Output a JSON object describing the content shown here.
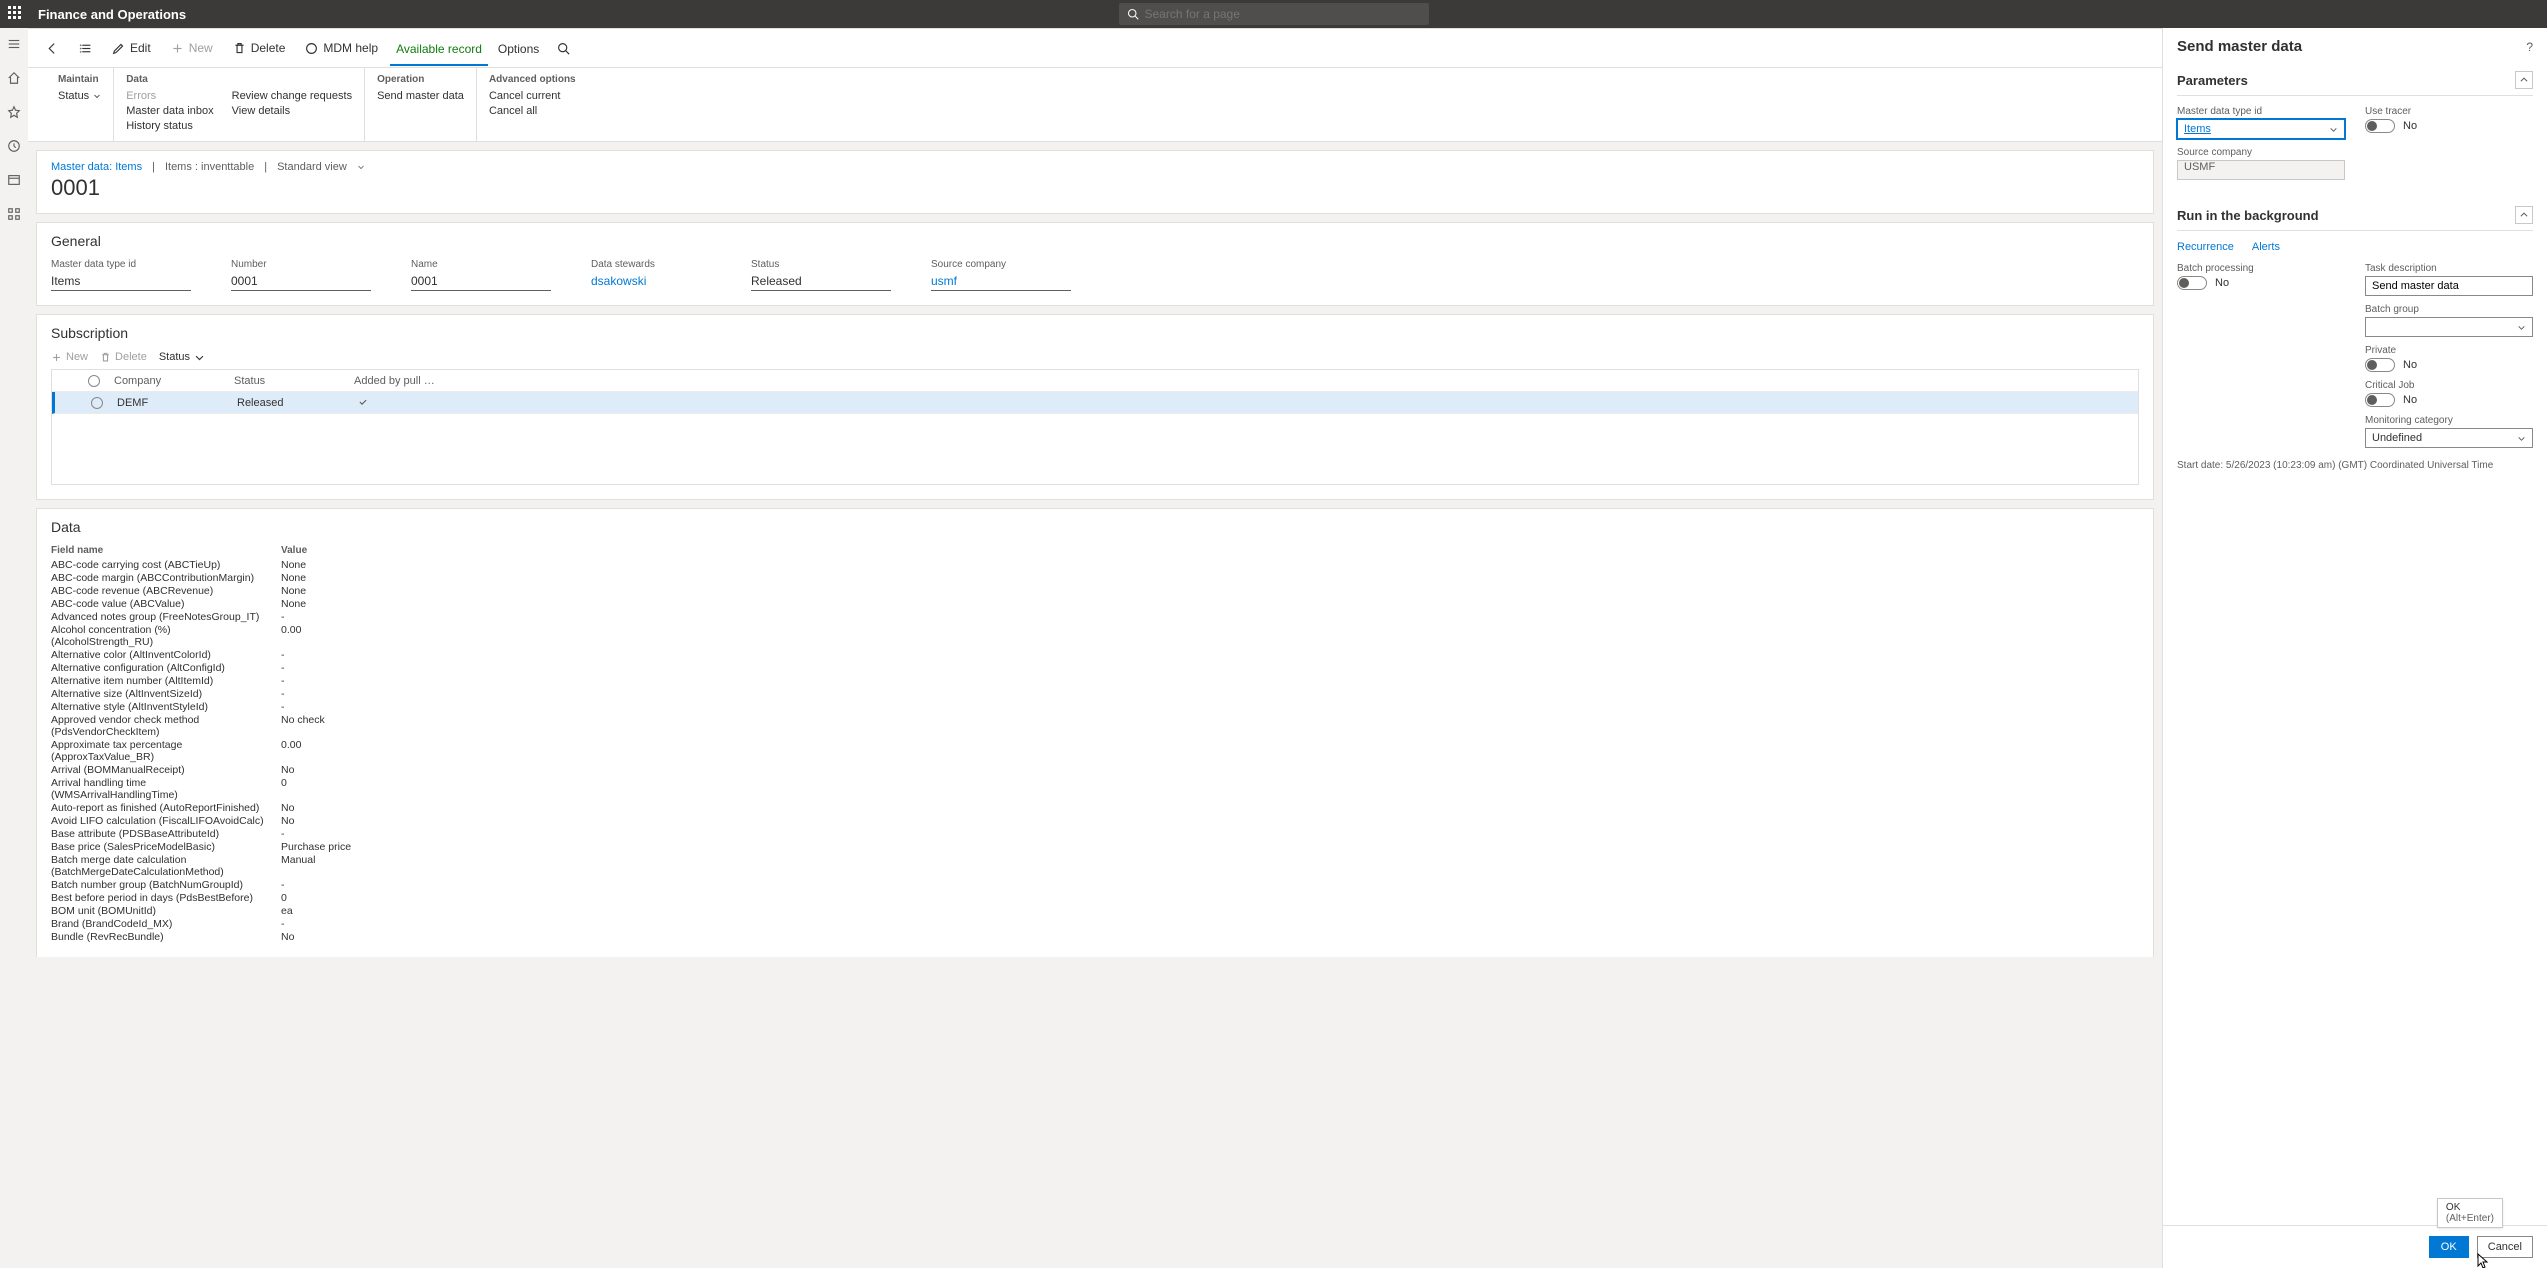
{
  "app_title": "Finance and Operations",
  "search_placeholder": "Search for a page",
  "actionbar": {
    "edit": "Edit",
    "new": "New",
    "delete": "Delete",
    "mdm_help": "MDM help",
    "available_record": "Available record",
    "options": "Options"
  },
  "ribbon": {
    "maintain": {
      "title": "Maintain",
      "status": "Status"
    },
    "data": {
      "title": "Data",
      "errors": "Errors",
      "inbox": "Master data inbox",
      "history": "History status",
      "review": "Review change requests",
      "view_details": "View details"
    },
    "operation": {
      "title": "Operation",
      "send": "Send master data"
    },
    "advanced": {
      "title": "Advanced options",
      "cancel_current": "Cancel current",
      "cancel_all": "Cancel all"
    }
  },
  "breadcrumb": {
    "link": "Master data: Items",
    "items": "Items : inventtable",
    "view": "Standard view"
  },
  "page_title": "0001",
  "general": {
    "title": "General",
    "fields": {
      "mdtid": {
        "label": "Master data type id",
        "value": "Items"
      },
      "number": {
        "label": "Number",
        "value": "0001"
      },
      "name": {
        "label": "Name",
        "value": "0001"
      },
      "stewards": {
        "label": "Data stewards",
        "value": "dsakowski"
      },
      "status": {
        "label": "Status",
        "value": "Released"
      },
      "company": {
        "label": "Source company",
        "value": "usmf"
      }
    }
  },
  "subscription": {
    "title": "Subscription",
    "toolbar": {
      "new": "New",
      "delete": "Delete",
      "status": "Status"
    },
    "columns": {
      "company": "Company",
      "status": "Status",
      "added": "Added by pull …"
    },
    "row": {
      "company": "DEMF",
      "status": "Released"
    }
  },
  "data_section": {
    "title": "Data",
    "headers": {
      "field": "Field name",
      "value": "Value"
    },
    "rows": [
      {
        "f": "ABC-code carrying cost (ABCTieUp)",
        "v": "None"
      },
      {
        "f": "ABC-code margin (ABCContributionMargin)",
        "v": "None"
      },
      {
        "f": "ABC-code revenue (ABCRevenue)",
        "v": "None"
      },
      {
        "f": "ABC-code value (ABCValue)",
        "v": "None"
      },
      {
        "f": "Advanced notes group (FreeNotesGroup_IT)",
        "v": "-"
      },
      {
        "f": "Alcohol concentration (%) (AlcoholStrength_RU)",
        "v": "0.00"
      },
      {
        "f": "Alternative color (AltInventColorId)",
        "v": "-"
      },
      {
        "f": "Alternative configuration (AltConfigId)",
        "v": "-"
      },
      {
        "f": "Alternative item number (AltItemId)",
        "v": "-"
      },
      {
        "f": "Alternative size (AltInventSizeId)",
        "v": "-"
      },
      {
        "f": "Alternative style (AltInventStyleId)",
        "v": "-"
      },
      {
        "f": "Approved vendor check method (PdsVendorCheckItem)",
        "v": "No check"
      },
      {
        "f": "Approximate tax percentage (ApproxTaxValue_BR)",
        "v": "0.00"
      },
      {
        "f": "Arrival (BOMManualReceipt)",
        "v": "No"
      },
      {
        "f": "Arrival handling time (WMSArrivalHandlingTime)",
        "v": "0"
      },
      {
        "f": "Auto-report as finished (AutoReportFinished)",
        "v": "No"
      },
      {
        "f": "Avoid LIFO calculation (FiscalLIFOAvoidCalc)",
        "v": "No"
      },
      {
        "f": "Base attribute (PDSBaseAttributeId)",
        "v": "-"
      },
      {
        "f": "Base price (SalesPriceModelBasic)",
        "v": "Purchase price"
      },
      {
        "f": "Batch merge date calculation (BatchMergeDateCalculationMethod)",
        "v": "Manual"
      },
      {
        "f": "Batch number group (BatchNumGroupId)",
        "v": "-"
      },
      {
        "f": "Best before period in days (PdsBestBefore)",
        "v": "0"
      },
      {
        "f": "BOM unit (BOMUnitId)",
        "v": "ea"
      },
      {
        "f": "Brand (BrandCodeId_MX)",
        "v": "-"
      },
      {
        "f": "Bundle (RevRecBundle)",
        "v": "No"
      }
    ]
  },
  "panel": {
    "title": "Send master data",
    "parameters": {
      "title": "Parameters",
      "mdtid_label": "Master data type id",
      "mdtid_value": "Items",
      "tracer_label": "Use tracer",
      "tracer_value": "No",
      "source_label": "Source company",
      "source_value": "USMF"
    },
    "background": {
      "title": "Run in the background",
      "tabs": {
        "recurrence": "Recurrence",
        "alerts": "Alerts"
      },
      "batch_label": "Batch processing",
      "batch_value": "No",
      "task_label": "Task description",
      "task_value": "Send master data",
      "batch_group_label": "Batch group",
      "private_label": "Private",
      "private_value": "No",
      "critical_label": "Critical Job",
      "critical_value": "No",
      "monitoring_label": "Monitoring category",
      "monitoring_value": "Undefined",
      "start_line": "Start date: 5/26/2023 (10:23:09 am) (GMT) Coordinated Universal Time"
    },
    "footer": {
      "ok": "OK",
      "cancel": "Cancel"
    },
    "tooltip": {
      "line1": "OK",
      "line2": "(Alt+Enter)"
    }
  }
}
